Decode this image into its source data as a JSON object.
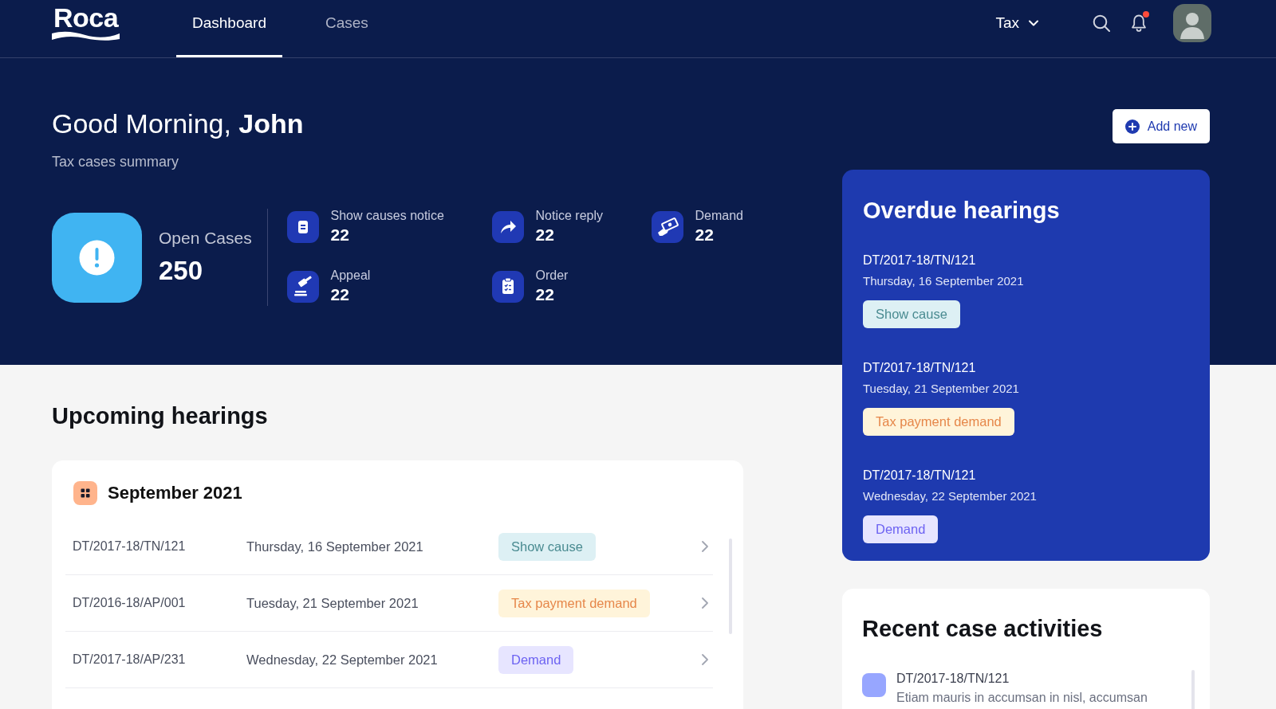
{
  "header": {
    "logo": "Roca",
    "tabs": [
      {
        "label": "Dashboard",
        "selected": true
      },
      {
        "label": "Cases",
        "selected": false
      }
    ],
    "module_menu": {
      "label": "Tax"
    },
    "notifications": {
      "unread": true
    }
  },
  "greeting": {
    "text": "Good Morning, **John**",
    "subtitle": "Tax cases summary"
  },
  "add_button": {
    "label": "Add new"
  },
  "open_cases": {
    "label": "Open Cases",
    "value": "250"
  },
  "stats": [
    {
      "label": "Show causes notice",
      "value": "22"
    },
    {
      "label": "Notice reply",
      "value": "22"
    },
    {
      "label": "Demand",
      "value": "22"
    },
    {
      "label": "Appeal",
      "value": "22"
    },
    {
      "label": "Order",
      "value": "22"
    }
  ],
  "overdue_hearings": {
    "title": "Overdue hearings",
    "items": [
      {
        "case_id": "DT/2017-18/TN/121",
        "date": "Thursday, 16 September 2021",
        "tag": {
          "label": "Show cause",
          "kind": "show_cause"
        }
      },
      {
        "case_id": "DT/2017-18/TN/121",
        "date": "Tuesday, 21 September 2021",
        "tag": {
          "label": "Tax payment demand",
          "kind": "payment"
        }
      },
      {
        "case_id": "DT/2017-18/TN/121",
        "date": "Wednesday, 22 September 2021",
        "tag": {
          "label": "Demand",
          "kind": "demand"
        }
      }
    ]
  },
  "upcoming_hearings": {
    "title": "Upcoming hearings",
    "month": "September 2021",
    "rows": [
      {
        "case_id": "DT/2017-18/TN/121",
        "date": "Thursday, 16 September 2021",
        "tag": {
          "label": "Show cause",
          "kind": "show_cause"
        }
      },
      {
        "case_id": "DT/2016-18/AP/001",
        "date": "Tuesday, 21 September 2021",
        "tag": {
          "label": "Tax payment demand",
          "kind": "payment"
        }
      },
      {
        "case_id": "DT/2017-18/AP/231",
        "date": "Wednesday, 22 September 2021",
        "tag": {
          "label": "Demand",
          "kind": "demand"
        }
      }
    ]
  },
  "recent_activities": {
    "title": "Recent case activities",
    "items": [
      {
        "case_id": "DT/2017-18/TN/121",
        "description": "Etiam mauris in accumsan in nisl, accumsan"
      }
    ]
  }
}
